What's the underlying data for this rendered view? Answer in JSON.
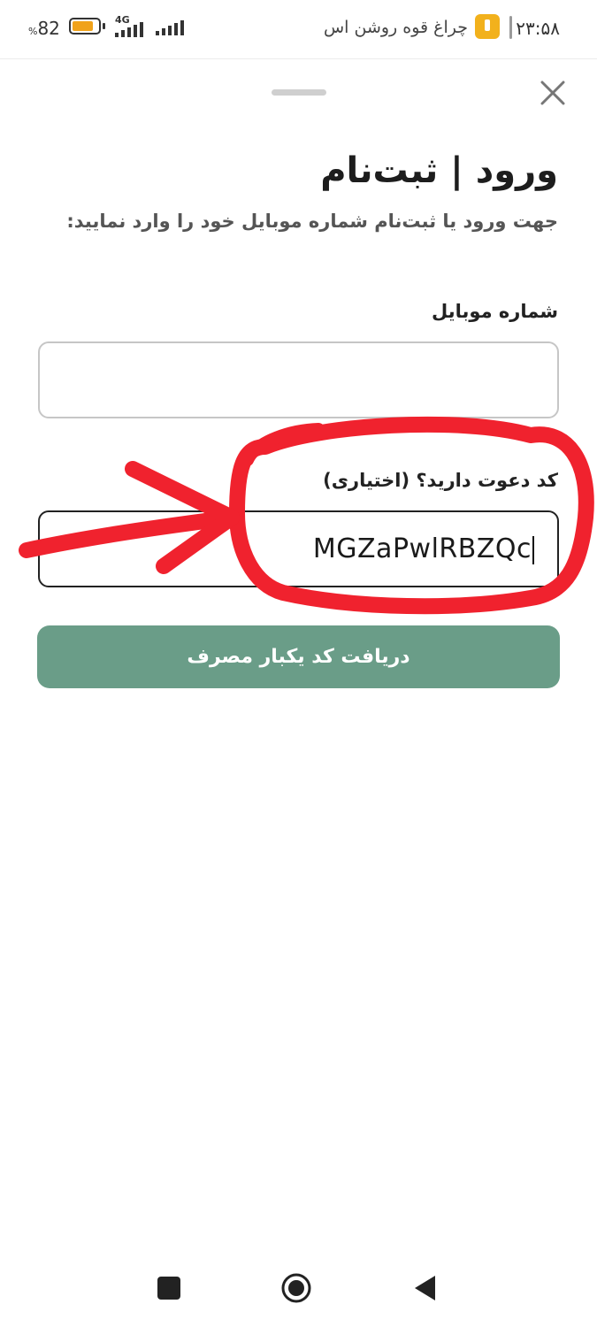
{
  "status_bar": {
    "time": "۲۳:۵۸",
    "notification_text": "چراغ قوه روشن اس",
    "battery_percent": "82",
    "battery_percent_sign": "%",
    "battery_level": 0.82,
    "network": "4G",
    "battery_color": "#f0a21a",
    "notification_icon": "flashlight-icon"
  },
  "sheet": {
    "title": "ورود | ثبت‌نام",
    "subtitle": "جهت ورود یا ثبت‌نام شماره موبایل خود را وارد نمایید:",
    "close_icon": "close-icon"
  },
  "form": {
    "mobile_label": "شماره موبایل",
    "mobile_value": "",
    "invite_label": "کد دعوت دارید؟ (اختیاری)",
    "invite_value": "MGZaPwlRBZQc",
    "submit_label": "دریافت کد یکبار مصرف",
    "submit_color": "#6a9d88"
  },
  "annotation": {
    "color": "#f0222e",
    "shapes": [
      "circle-annotation",
      "arrow-annotation"
    ]
  },
  "nav_bar": {
    "icons": [
      "recents-icon",
      "home-icon",
      "back-icon"
    ]
  }
}
